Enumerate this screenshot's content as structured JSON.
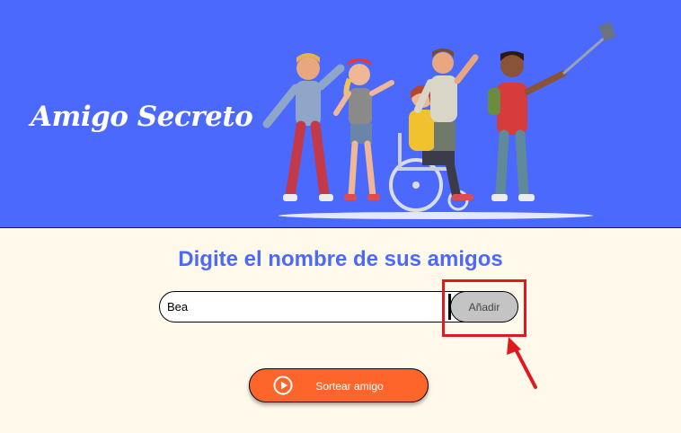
{
  "header": {
    "title": "Amigo Secreto",
    "illustration_icon": "group-of-friends-selfie-illustration"
  },
  "main": {
    "subtitle": "Digite el nombre de sus amigos",
    "input": {
      "value": "Bea",
      "placeholder": ""
    },
    "add_button_label": "Añadir",
    "draw_button_label": "Sortear amigo",
    "draw_button_icon": "play-circle-icon"
  },
  "annotation": {
    "highlight_color": "#e0191f",
    "arrow_icon": "red-arrow-icon"
  },
  "colors": {
    "header_bg": "#4b69fd",
    "page_bg": "#fff9eb",
    "accent_orange": "#fe652b",
    "subtitle_blue": "#4b69fd",
    "add_button_bg": "#c4c4c4"
  }
}
